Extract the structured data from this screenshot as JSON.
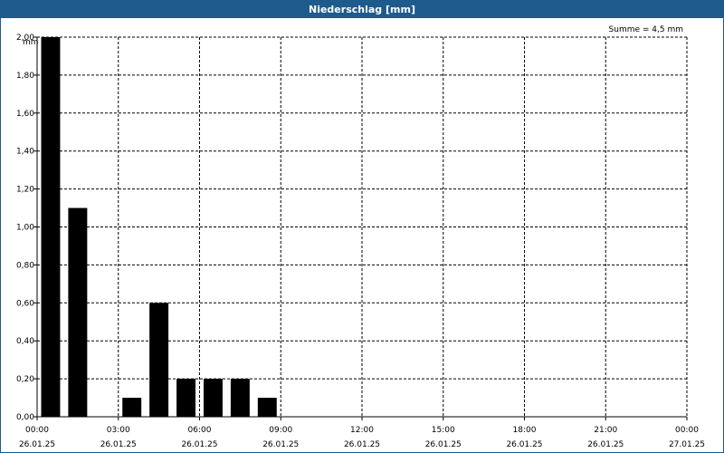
{
  "window": {
    "title": "Niederschlag [mm]"
  },
  "chart_data": {
    "type": "bar",
    "title": "Niederschlag [mm]",
    "ylabel": "mm",
    "summary": "Summe = 4,5 mm",
    "ylim": [
      0,
      2.0
    ],
    "xlim_hours": [
      0,
      24
    ],
    "grid": true,
    "yticks": [
      "0,00",
      "0,20",
      "0,40",
      "0,60",
      "0,80",
      "1,00",
      "1,20",
      "1,40",
      "1,60",
      "1,80",
      "2,00"
    ],
    "xticks": [
      {
        "time": "00:00",
        "date": "26.01.25"
      },
      {
        "time": "03:00",
        "date": "26.01.25"
      },
      {
        "time": "06:00",
        "date": "26.01.25"
      },
      {
        "time": "09:00",
        "date": "26.01.25"
      },
      {
        "time": "12:00",
        "date": "26.01.25"
      },
      {
        "time": "15:00",
        "date": "26.01.25"
      },
      {
        "time": "18:00",
        "date": "26.01.25"
      },
      {
        "time": "21:00",
        "date": "26.01.25"
      },
      {
        "time": "00:00",
        "date": "27.01.25"
      }
    ],
    "categories": [
      "00:00",
      "01:00",
      "02:00",
      "03:00",
      "04:00",
      "05:00",
      "06:00",
      "07:00",
      "08:00"
    ],
    "values": [
      2.0,
      1.1,
      0.0,
      0.1,
      0.6,
      0.2,
      0.2,
      0.2,
      0.1
    ],
    "bar_color": "#000000",
    "grid_color": "#000000"
  }
}
